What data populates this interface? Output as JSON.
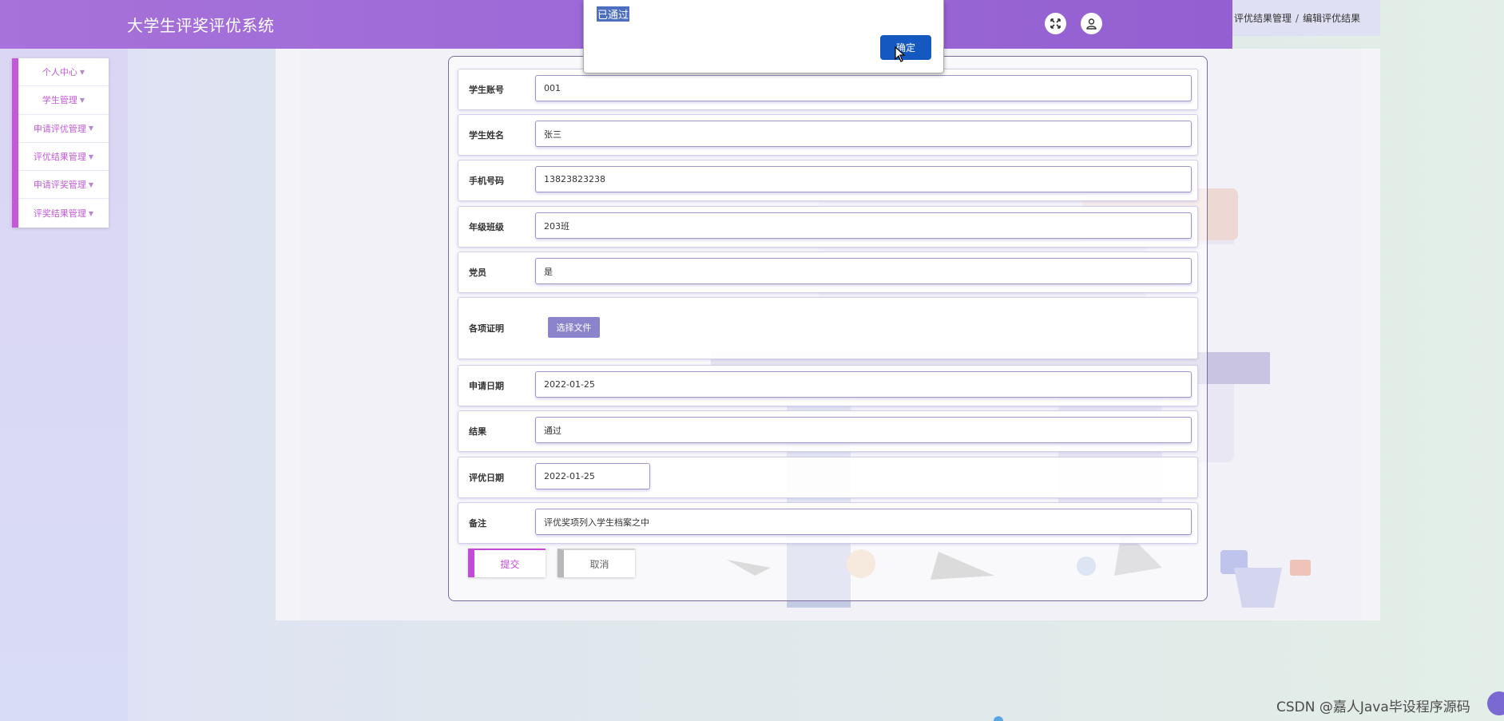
{
  "app": {
    "title": "大学生评奖评优系统"
  },
  "header": {
    "fullscreen_icon": "expand-icon",
    "user_icon": "user-icon"
  },
  "breadcrumb": {
    "section": "评优结果管理",
    "separator": "/",
    "page": "编辑评优结果"
  },
  "sidebar": {
    "items": [
      {
        "label": "个人中心"
      },
      {
        "label": "学生管理"
      },
      {
        "label": "申请评优管理"
      },
      {
        "label": "评优结果管理"
      },
      {
        "label": "申请评奖管理"
      },
      {
        "label": "评奖结果管理"
      }
    ]
  },
  "form": {
    "fields": [
      {
        "label": "学生账号",
        "value": "001"
      },
      {
        "label": "学生姓名",
        "value": "张三"
      },
      {
        "label": "手机号码",
        "value": "13823823238"
      },
      {
        "label": "年级班级",
        "value": "203班"
      },
      {
        "label": "党员",
        "value": "是"
      },
      {
        "label": "各项证明",
        "button": "选择文件"
      },
      {
        "label": "申请日期",
        "value": "2022-01-25"
      },
      {
        "label": "结果",
        "value": "通过"
      },
      {
        "label": "评优日期",
        "value": "2022-01-25"
      },
      {
        "label": "备注",
        "value": "评优奖项列入学生档案之中"
      }
    ],
    "submit_label": "提交",
    "cancel_label": "取消"
  },
  "dialog": {
    "message": "已通过",
    "ok_label": "确定"
  },
  "watermark": "CSDN @嘉人Java毕设程序源码",
  "colors": {
    "header_start": "#a772d9",
    "header_end": "#9460d1",
    "menu_accent": "#c757d9",
    "menu_text": "#c15ad5",
    "file_button": "#8a84cc",
    "dialog_ok": "#1558c0"
  }
}
